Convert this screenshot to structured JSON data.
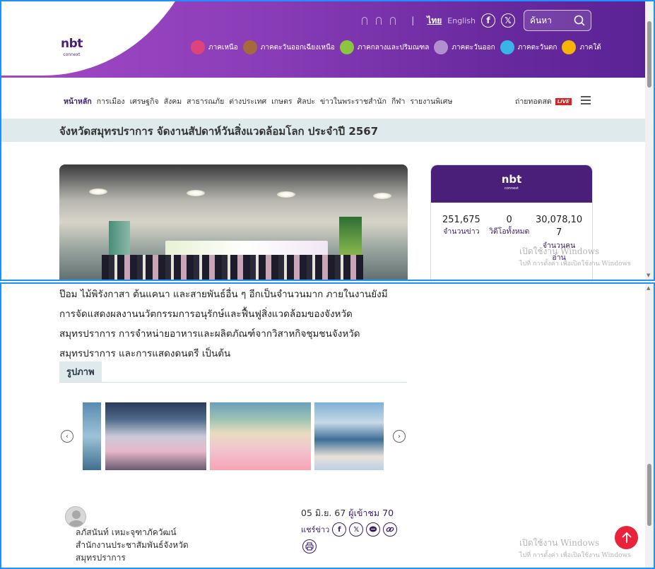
{
  "header": {
    "logo_main": "nbt",
    "logo_sub": "connext",
    "lang_th": "ไทย",
    "lang_en": "English",
    "search_placeholder": "ค้นหา"
  },
  "regions": [
    {
      "label": "ภาคเหนือ",
      "color": "#e0437a"
    },
    {
      "label": "ภาคตะวันออกเฉียงเหนือ",
      "color": "#a56a3c"
    },
    {
      "label": "ภาคกลางและปริมณฑล",
      "color": "#8cc63e"
    },
    {
      "label": "ภาคตะวันออก",
      "color": "#b38fcf"
    },
    {
      "label": "ภาคตะวันตก",
      "color": "#38b4e6"
    },
    {
      "label": "ภาคใต้",
      "color": "#f5b400"
    }
  ],
  "nav": {
    "items": [
      "หน้าหลัก",
      "การเมือง",
      "เศรษฐกิจ",
      "สังคม",
      "สาธารณภัย",
      "ต่างประเทศ",
      "เกษตร",
      "ศิลปะ",
      "ข่าวในพระราชสำนัก",
      "กีฬา",
      "รายงานพิเศษ"
    ],
    "live_label": "ถ่ายทอดสด",
    "live_badge": "LIVE"
  },
  "article": {
    "title": "จังหวัดสมุทรปราการ จัดงานสัปดาห์วันสิ่งแวดล้อมโลก ประจำปี 2567",
    "body_lines": [
      "ป๊อม  ไม้พิรังกาสา ต้นแคนา และสายพันธ์อื่น ๆ อีกเป็นจำนวนมาก ภายในงานยังมี",
      "การจัดแสดงผลงานนวัตกรรมการอนุรักษ์และฟื้นฟูสิ่งแวดล้อมของจังหวัด",
      "สมุทรปราการ การจำหน่ายอาหารและผลิตภัณฑ์จากวิสาหกิจชุมชนจังหวัด",
      "สมุทรปราการ และการแสดงดนตรี เป็นต้น"
    ],
    "gallery_title": "รูปภาพ",
    "author_name": "ลภัสนันท์ เหมะจุฑาภัควัฒน์",
    "author_org_line1": "สำนักงานประชาสัมพันธ์จังหวัด",
    "author_org_line2": "สมุทรปราการ",
    "date": "05 มิ.ย. 67",
    "views_label": "ผู้เข้าชม",
    "views_count": "70",
    "share_label": "แชร์ข่าว"
  },
  "stats": {
    "logo_main": "nbt",
    "logo_sub": "connext",
    "news_count": "251,675",
    "news_label": "จำนวนข่าว",
    "video_count": "0",
    "video_label": "วิดีโอทั้งหมด",
    "readers_count_line1": "30,078,10",
    "readers_count_line2": "7",
    "readers_label_line1": "จำนวนคน",
    "readers_label_line2": "อ่าน"
  },
  "watermark": {
    "line1": "เปิดใช้งาน Windows",
    "line2": "ไปที่ การตั้งค่า เพื่อเปิดใช้งาน Windows"
  }
}
